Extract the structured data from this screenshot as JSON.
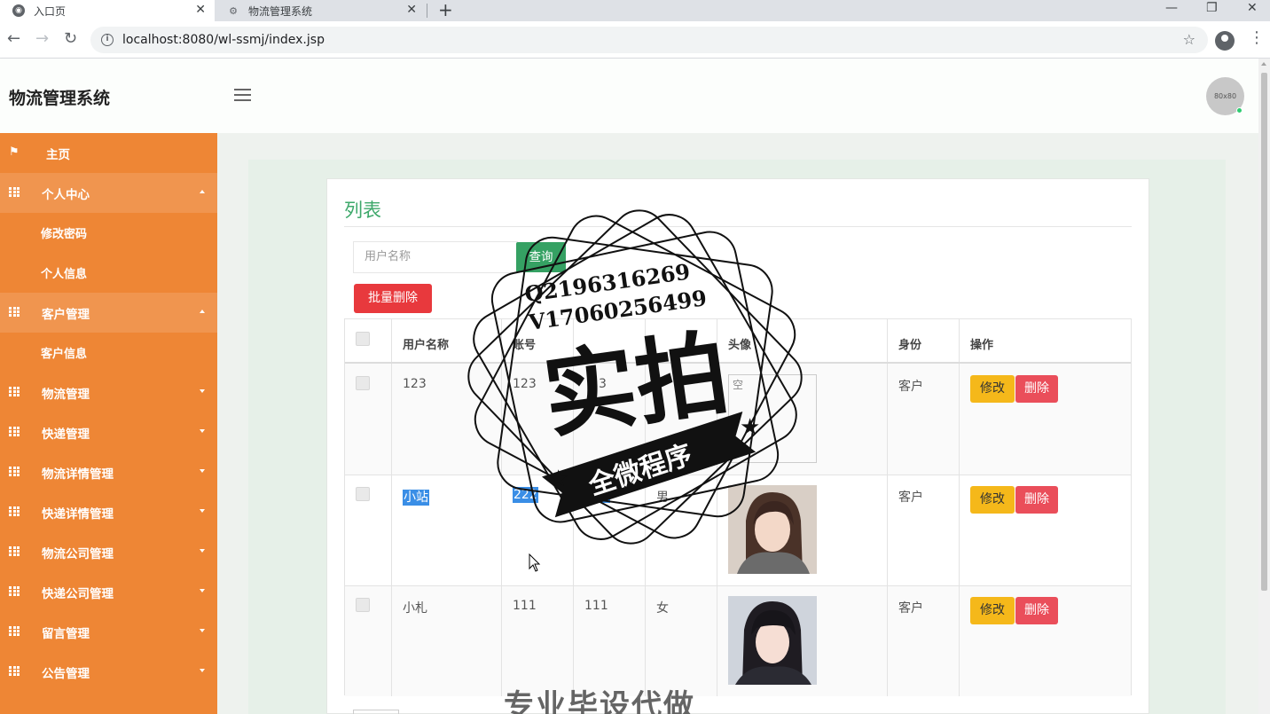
{
  "browser": {
    "tabs": [
      {
        "label": "入口页",
        "active": true
      },
      {
        "label": "物流管理系统",
        "active": false
      }
    ],
    "new_tab_label": "+",
    "url": "localhost:8080/wl-ssmj/index.jsp"
  },
  "header": {
    "title": "物流管理系统",
    "avatar_text": "80x80"
  },
  "sidebar": {
    "home": "主页",
    "items": [
      {
        "label": "个人中心",
        "open": true,
        "children": [
          "修改密码",
          "个人信息"
        ]
      },
      {
        "label": "客户管理",
        "open": true,
        "children": [
          "客户信息"
        ]
      },
      {
        "label": "物流管理",
        "open": false
      },
      {
        "label": "快递管理",
        "open": false
      },
      {
        "label": "物流详情管理",
        "open": false
      },
      {
        "label": "快递详情管理",
        "open": false
      },
      {
        "label": "物流公司管理",
        "open": false
      },
      {
        "label": "快递公司管理",
        "open": false
      },
      {
        "label": "留言管理",
        "open": false
      },
      {
        "label": "公告管理",
        "open": false
      }
    ]
  },
  "main": {
    "title": "列表",
    "search_placeholder": "用户名称",
    "search_button": "查询",
    "batch_delete": "批量删除",
    "columns": [
      "用户名称",
      "账号",
      "",
      "",
      "头像",
      "身份",
      "操作"
    ],
    "rows": [
      {
        "name": "123",
        "account": "123",
        "col3": "3",
        "col4": "",
        "avatar_text": "空",
        "role": "客户"
      },
      {
        "name": "小站",
        "account": "222",
        "col3": "222",
        "col4": "男",
        "avatar_text": "",
        "role": "客户"
      },
      {
        "name": "小札",
        "account": "111",
        "col3": "111",
        "col4": "女",
        "avatar_text": "",
        "role": "客户"
      }
    ],
    "edit_label": "修改",
    "delete_label": "删除"
  },
  "watermark": {
    "line1": "Q2196316269",
    "line2": "V17060256499",
    "big": "实拍",
    "banner": "全微程序",
    "bottom": "专业毕设代做"
  },
  "colors": {
    "sidebar": "#ee8635",
    "accent_green": "#35a163",
    "danger": "#e8393d",
    "warning": "#f5b81a"
  }
}
